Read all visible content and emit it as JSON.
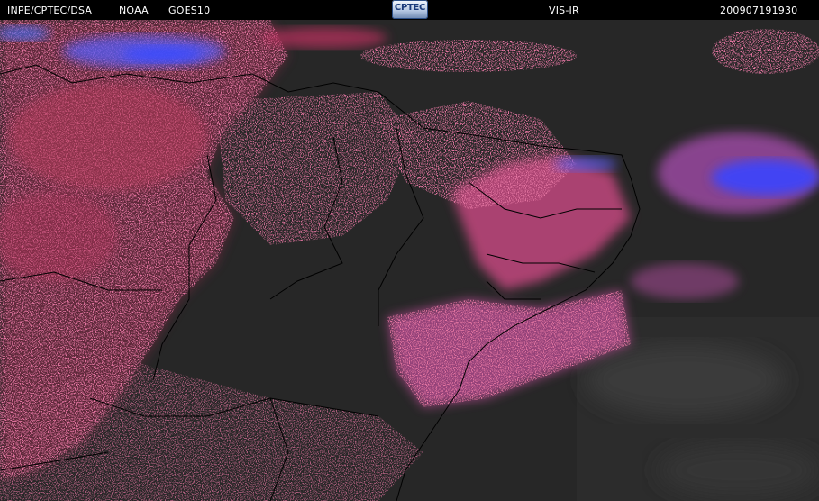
{
  "header": {
    "org": "INPE/CPTEC/DSA",
    "agency": "NOAA",
    "satellite": "GOES10",
    "channel": "VIS-IR",
    "datetime": "200907191930"
  },
  "logo": {
    "text": "CPTEC"
  },
  "colors": {
    "background": "#262626",
    "cloud_low": "#c0305a",
    "cloud_mid": "#b04a8e",
    "cloud_high": "#3a4cff",
    "borders": "#000000"
  },
  "icons": [
    "cptec-logo"
  ]
}
